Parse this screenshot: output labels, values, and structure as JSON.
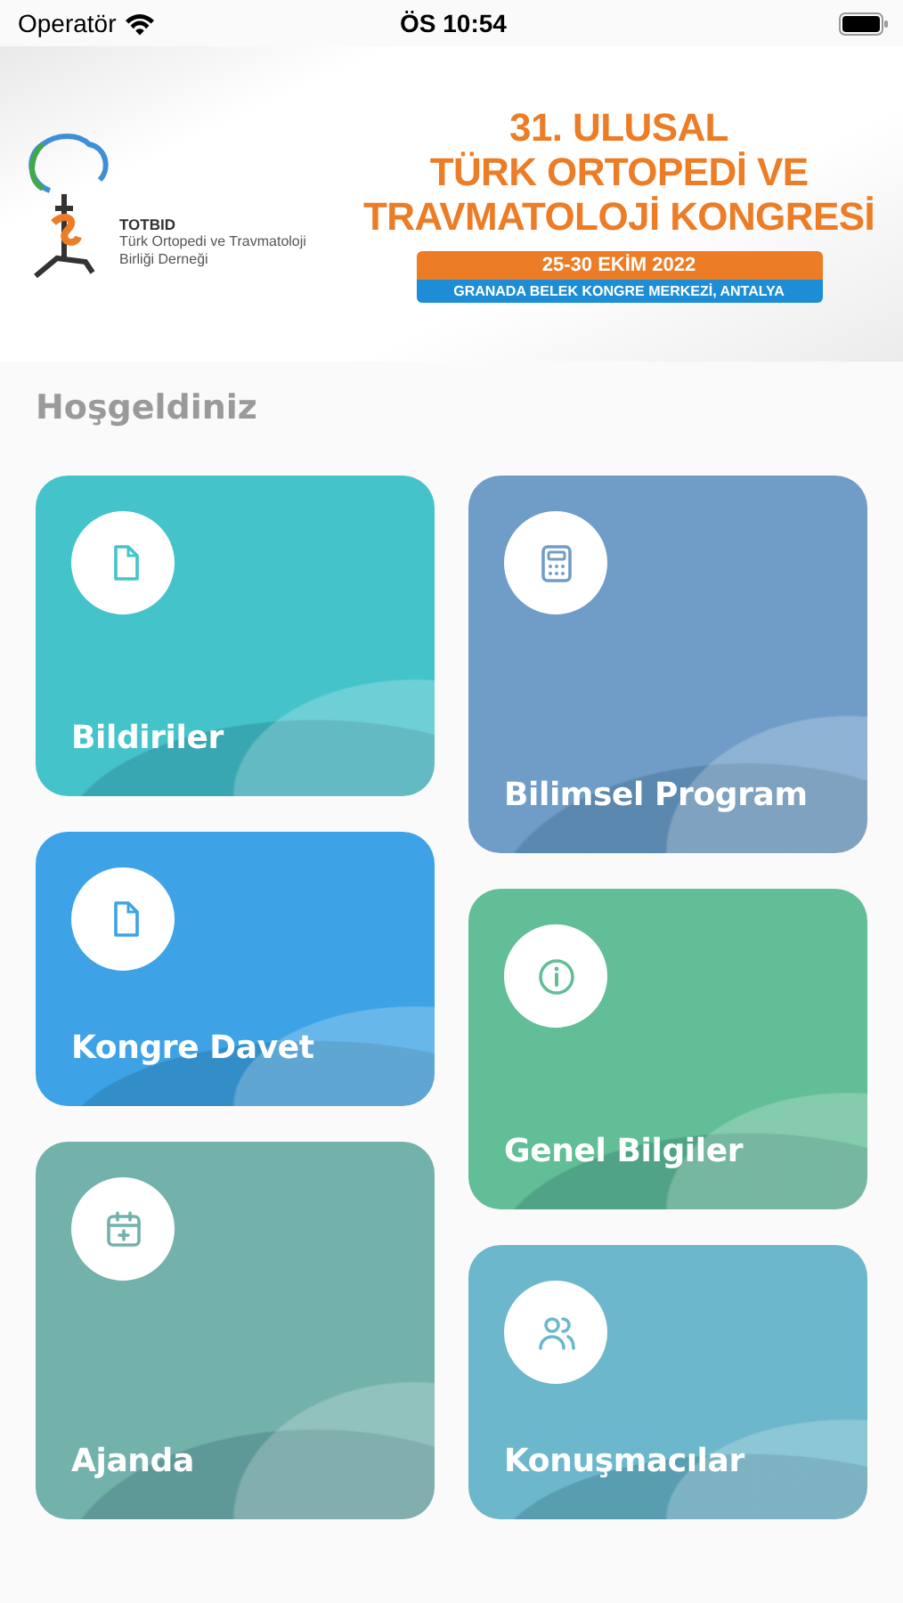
{
  "status_bar": {
    "carrier": "Operatör",
    "time": "ÖS 10:54"
  },
  "banner": {
    "logo_title": "TOTBID",
    "logo_lines": [
      "Türk Ortopedi ve Travmatoloji",
      "Birliği Derneği"
    ],
    "title_lines": [
      "31. ULUSAL",
      "TÜRK ORTOPEDİ VE",
      "TRAVMATOLOJİ KONGRESİ"
    ],
    "date": "25-30 EKİM 2022",
    "venue": "GRANADA BELEK KONGRE MERKEZİ, ANTALYA"
  },
  "heading": "Hoşgeldiniz",
  "columns": [
    [
      {
        "label": "Bildiriler",
        "color": "#45c3cb"
      },
      {
        "label": "Kongre Davet",
        "color": "#3ea3e6"
      },
      {
        "label": "Ajanda",
        "color": "#73b1ab"
      }
    ],
    [
      {
        "label": "Bilimsel Program",
        "color": "#6f9dc8"
      },
      {
        "label": "Genel Bilgiler",
        "color": "#62be96"
      },
      {
        "label": "Konuşmacılar",
        "color": "#6cb7cb"
      }
    ]
  ]
}
